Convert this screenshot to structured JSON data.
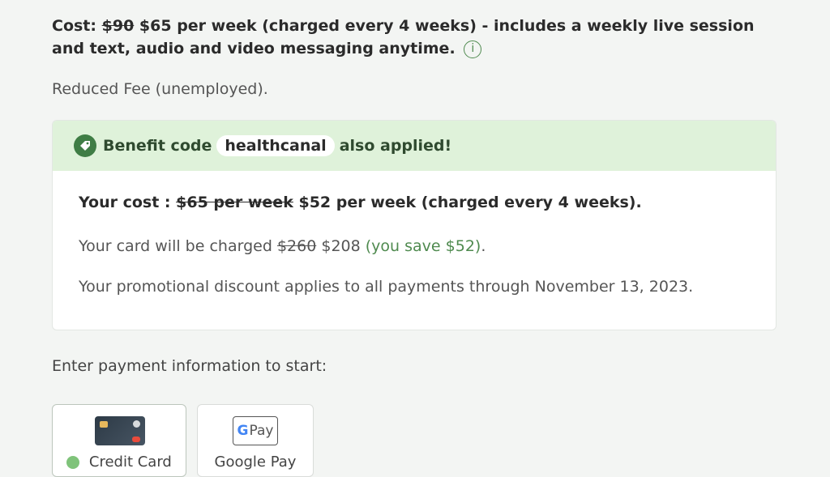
{
  "cost": {
    "label": "Cost:",
    "old_price": "$90",
    "new_price_text": "$65 per week (charged every 4 weeks) - includes a weekly live session and text, audio and video messaging anytime.",
    "info_glyph": "i"
  },
  "reduced_fee": "Reduced Fee (unemployed).",
  "benefit": {
    "prefix": "Benefit code",
    "code": "healthcanal",
    "suffix": "also applied!",
    "your_cost_label": "Your cost :",
    "your_cost_old": "$65 per week",
    "your_cost_new": "$52 per week (charged every 4 weeks).",
    "charge_prefix": "Your card will be charged",
    "charge_old": "$260",
    "charge_new": "$208",
    "charge_save": "(you save $52)",
    "charge_end": ".",
    "promo_text": "Your promotional discount applies to all payments through November 13, 2023."
  },
  "payment": {
    "label": "Enter payment information to start:",
    "options": [
      {
        "label": "Credit Card",
        "selected": true
      },
      {
        "label": "Google Pay",
        "selected": false
      }
    ],
    "gpay_badge_text": "Pay",
    "gpay_g": "G"
  },
  "colors": {
    "accent_green": "#4f8a4f",
    "header_bg": "#dff2da",
    "page_bg": "#f3f5f3"
  }
}
